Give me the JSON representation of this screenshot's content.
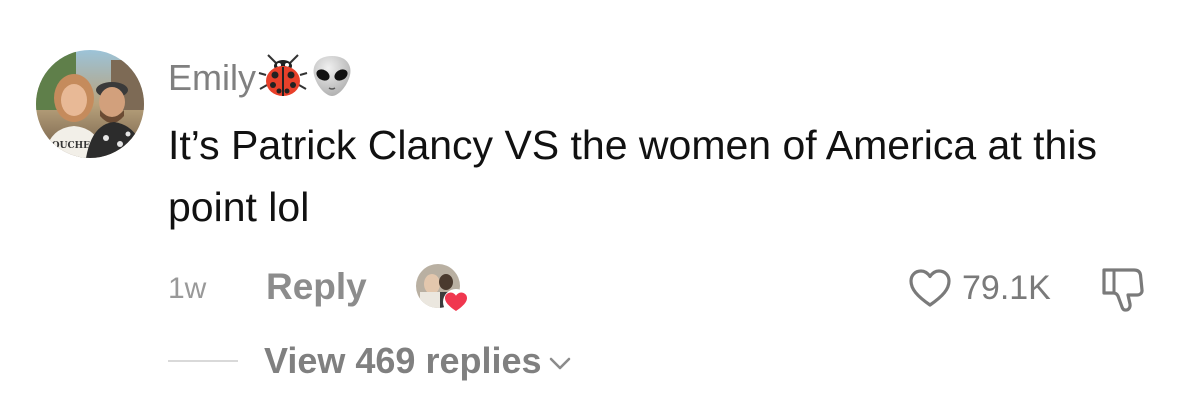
{
  "comment": {
    "username": "Emily",
    "username_emojis": [
      "ladybug-icon",
      "alien-icon"
    ],
    "text": "It’s Patrick Clancy VS the women of America at this point lol",
    "timestamp": "1w",
    "reply_label": "Reply",
    "creator_liked": true,
    "like_count": "79.1K",
    "view_replies_label": "View 469 replies"
  },
  "colors": {
    "text": "#111111",
    "muted": "#808080",
    "heart_badge": "#f0374f"
  }
}
